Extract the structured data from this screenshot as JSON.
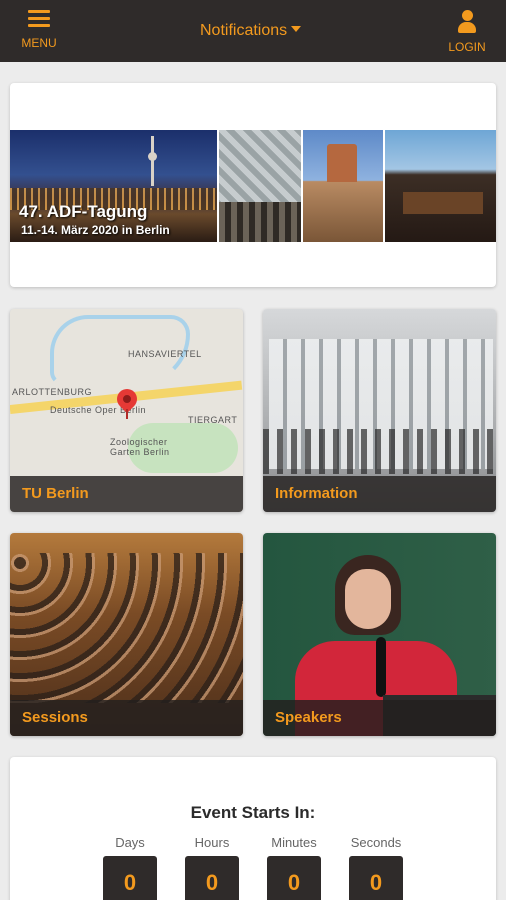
{
  "header": {
    "menu_label": "MENU",
    "notifications_label": "Notifications",
    "login_label": "LOGIN",
    "accent_color": "#f39a1e",
    "background_color": "#2f2b2a"
  },
  "banner": {
    "title": "47. ADF-Tagung",
    "subtitle": "11.-14. März 2020 in Berlin"
  },
  "tiles": [
    {
      "label": "TU Berlin",
      "icon": "map-icon"
    },
    {
      "label": "Information",
      "icon": "poster-hall-photo"
    },
    {
      "label": "Sessions",
      "icon": "audience-photo"
    },
    {
      "label": "Speakers",
      "icon": "speaker-photo"
    }
  ],
  "map": {
    "labels": [
      "HANSAVIERTEL",
      "ARLOTTENBURG",
      "Deutsche Oper Berlin",
      "TIERGART",
      "Zoologischer Garten Berlin"
    ]
  },
  "countdown": {
    "title": "Event Starts In:",
    "units": [
      {
        "label": "Days",
        "value": "0"
      },
      {
        "label": "Hours",
        "value": "0"
      },
      {
        "label": "Minutes",
        "value": "0"
      },
      {
        "label": "Seconds",
        "value": "0"
      }
    ]
  }
}
